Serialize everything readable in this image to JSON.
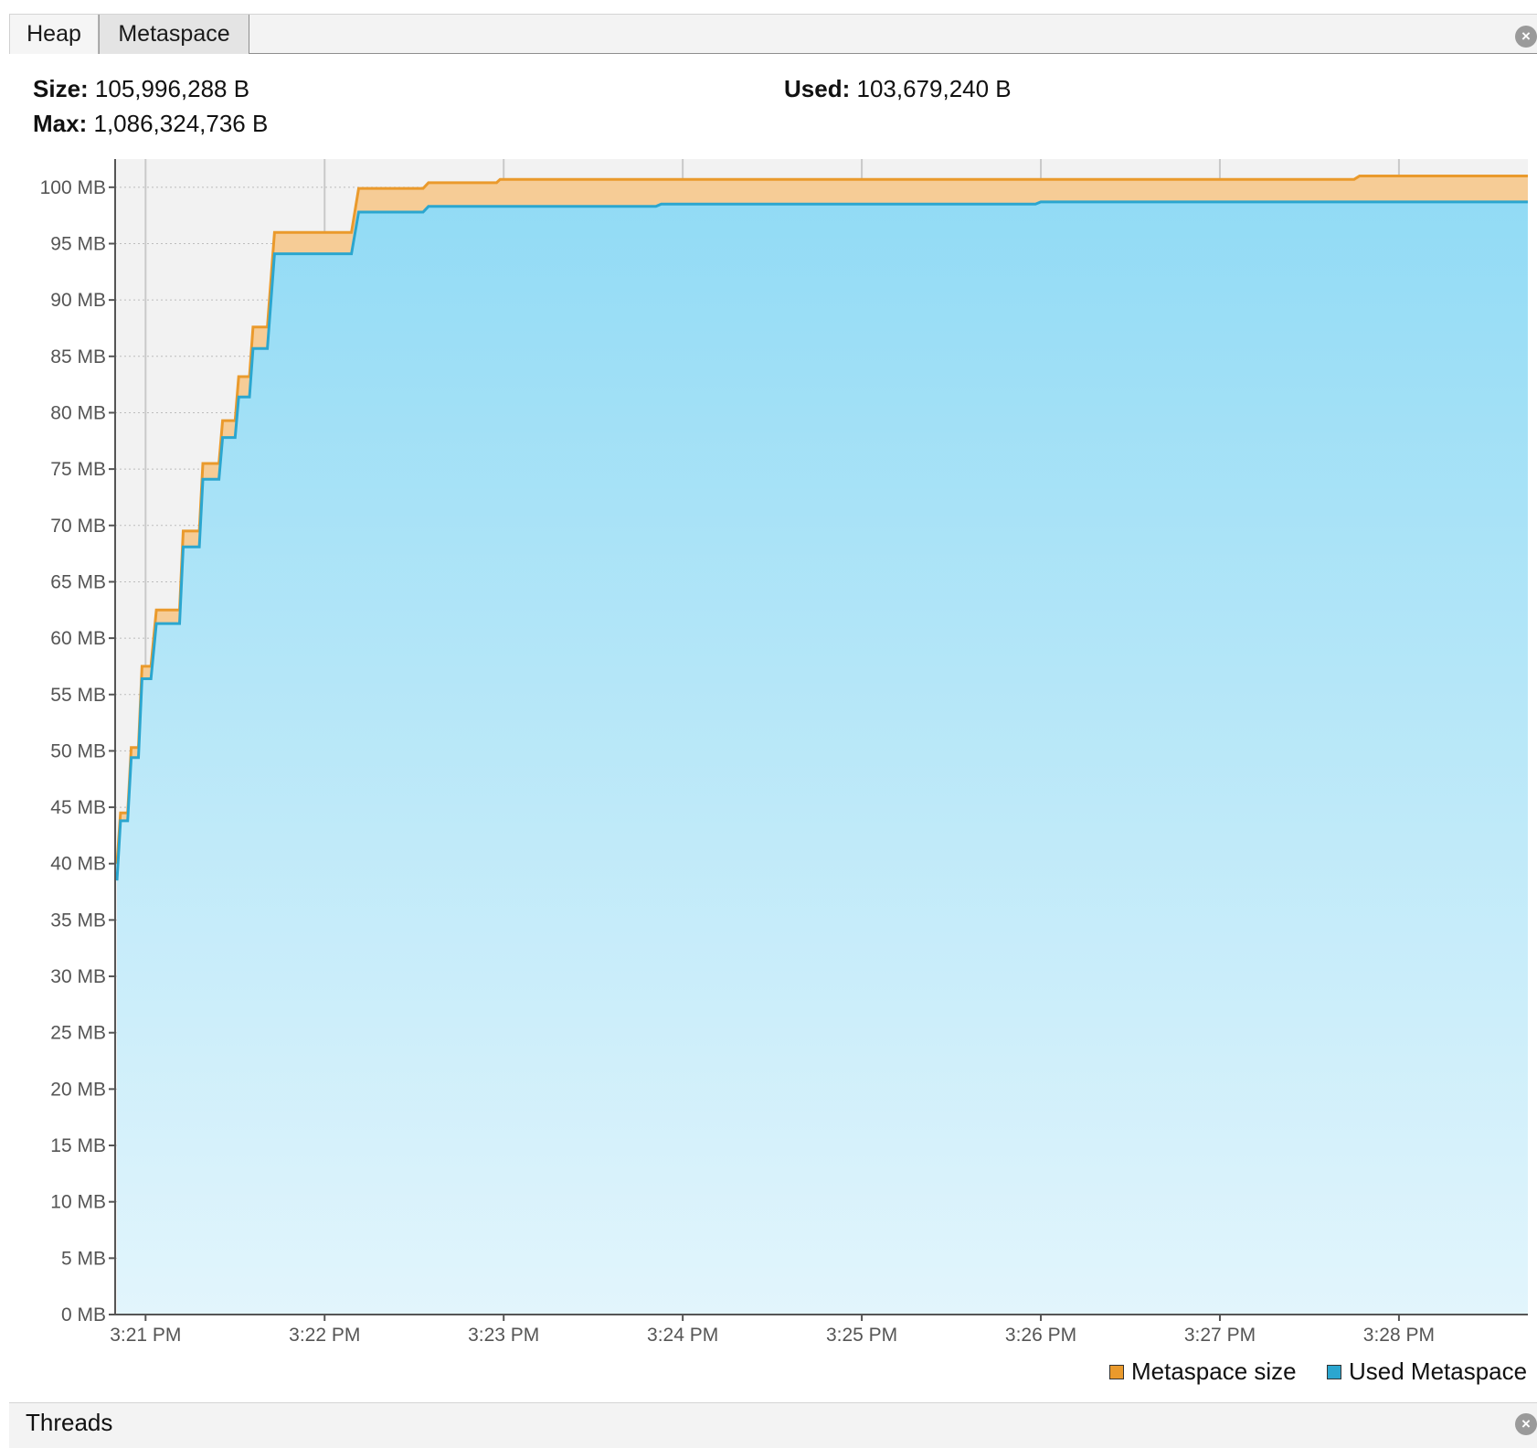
{
  "tabs": {
    "heap": "Heap",
    "metaspace": "Metaspace"
  },
  "stats": {
    "size_label": "Size:",
    "size_value": "105,996,288 B",
    "max_label": "Max:",
    "max_value": "1,086,324,736 B",
    "used_label": "Used:",
    "used_value": "103,679,240 B"
  },
  "bottom_panel": {
    "title": "Threads"
  },
  "icons": {
    "close": "close-icon"
  },
  "colors": {
    "size_line": "#ea9a2c",
    "size_fill": "#f6cc96",
    "used_line": "#2ba6cf",
    "used_fill_top": "#92dbf5",
    "used_fill_bottom": "#e2f5fc",
    "plot_bg": "#f2f2f2"
  },
  "chart_data": {
    "type": "area",
    "x_unit": "minutes after 3:20 PM",
    "xlim": [
      20.83,
      28.72
    ],
    "ylim": [
      0,
      102.5
    ],
    "ytick_values": [
      0,
      5,
      10,
      15,
      20,
      25,
      30,
      35,
      40,
      45,
      50,
      55,
      60,
      65,
      70,
      75,
      80,
      85,
      90,
      95,
      100
    ],
    "ytick_labels": [
      "0 MB",
      "5 MB",
      "10 MB",
      "15 MB",
      "20 MB",
      "25 MB",
      "30 MB",
      "35 MB",
      "40 MB",
      "45 MB",
      "50 MB",
      "55 MB",
      "60 MB",
      "65 MB",
      "70 MB",
      "75 MB",
      "80 MB",
      "85 MB",
      "90 MB",
      "95 MB",
      "100 MB"
    ],
    "xtick_values": [
      21,
      22,
      23,
      24,
      25,
      26,
      27,
      28
    ],
    "xtick_labels": [
      "3:21 PM",
      "3:22 PM",
      "3:23 PM",
      "3:24 PM",
      "3:25 PM",
      "3:26 PM",
      "3:27 PM",
      "3:28 PM"
    ],
    "grid": true,
    "legend_position": "bottom-right",
    "series": [
      {
        "name": "Metaspace size",
        "points": [
          [
            20.84,
            40.0
          ],
          [
            20.86,
            44.5
          ],
          [
            20.9,
            44.5
          ],
          [
            20.92,
            50.3
          ],
          [
            20.96,
            50.3
          ],
          [
            20.98,
            57.5
          ],
          [
            21.03,
            57.5
          ],
          [
            21.06,
            62.5
          ],
          [
            21.19,
            62.5
          ],
          [
            21.21,
            69.5
          ],
          [
            21.3,
            69.5
          ],
          [
            21.32,
            75.5
          ],
          [
            21.41,
            75.5
          ],
          [
            21.43,
            79.3
          ],
          [
            21.5,
            79.3
          ],
          [
            21.52,
            83.2
          ],
          [
            21.58,
            83.2
          ],
          [
            21.6,
            87.6
          ],
          [
            21.68,
            87.6
          ],
          [
            21.72,
            96.0
          ],
          [
            22.15,
            96.0
          ],
          [
            22.19,
            99.9
          ],
          [
            22.55,
            99.9
          ],
          [
            22.58,
            100.4
          ],
          [
            22.96,
            100.4
          ],
          [
            22.98,
            100.7
          ],
          [
            27.75,
            100.7
          ],
          [
            27.78,
            101.0
          ],
          [
            28.72,
            101.0
          ]
        ]
      },
      {
        "name": "Used Metaspace",
        "points": [
          [
            20.84,
            38.5
          ],
          [
            20.86,
            43.8
          ],
          [
            20.9,
            43.8
          ],
          [
            20.92,
            49.4
          ],
          [
            20.96,
            49.4
          ],
          [
            20.98,
            56.4
          ],
          [
            21.03,
            56.4
          ],
          [
            21.06,
            61.3
          ],
          [
            21.19,
            61.3
          ],
          [
            21.21,
            68.1
          ],
          [
            21.3,
            68.1
          ],
          [
            21.32,
            74.1
          ],
          [
            21.41,
            74.1
          ],
          [
            21.43,
            77.8
          ],
          [
            21.5,
            77.8
          ],
          [
            21.52,
            81.4
          ],
          [
            21.58,
            81.4
          ],
          [
            21.6,
            85.7
          ],
          [
            21.68,
            85.7
          ],
          [
            21.72,
            94.1
          ],
          [
            22.15,
            94.1
          ],
          [
            22.19,
            97.8
          ],
          [
            22.55,
            97.8
          ],
          [
            22.58,
            98.3
          ],
          [
            23.85,
            98.3
          ],
          [
            23.88,
            98.5
          ],
          [
            25.97,
            98.5
          ],
          [
            26.0,
            98.7
          ],
          [
            28.72,
            98.7
          ]
        ]
      }
    ]
  }
}
